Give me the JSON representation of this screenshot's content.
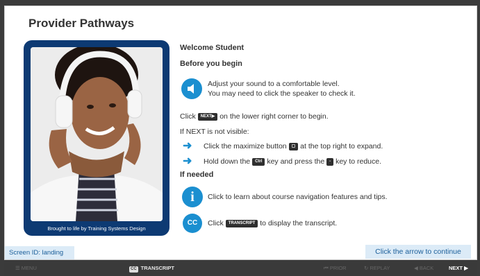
{
  "title": "Provider Pathways",
  "photo": {
    "caption": "Brought to life by Training Systems Design"
  },
  "content": {
    "welcome": "Welcome Student",
    "before_heading": "Before you begin",
    "sound_line1": "Adjust your sound to a comfortable level.",
    "sound_line2": "You may need to click the speaker to check it.",
    "click_prefix": "Click",
    "next_key": "NEXT▶",
    "click_suffix": "on the lower right corner to begin.",
    "if_next": "If NEXT is not visible:",
    "maximize_prefix": "Click the maximize button",
    "maximize_suffix": "at the top right to expand.",
    "hold_prefix": "Hold down the",
    "ctrl_key": "Ctrl",
    "hold_middle": "key and press the",
    "minus_key": "-",
    "hold_suffix": "key to reduce.",
    "if_needed": "If needed",
    "info_text": "Click to learn about course navigation features and tips.",
    "transcript_prefix": "Click",
    "transcript_key": "TRANSCRIPT",
    "transcript_suffix": "to display the transcript.",
    "info_glyph": "i",
    "cc_glyph": "CC"
  },
  "footer": {
    "screen_id": "Screen ID: landing",
    "continue": "Click the arrow to continue"
  },
  "navbar": {
    "menu": "☰ MENU",
    "transcript": "TRANSCRIPT",
    "prior": "⏮ PRIOR",
    "replay": "↻ REPLAY",
    "back": "◀ BACK",
    "next": "NEXT ▶"
  },
  "colors": {
    "accent": "#1b8fd0",
    "frame": "#0d3a73",
    "note_bg": "#dcebf7"
  }
}
